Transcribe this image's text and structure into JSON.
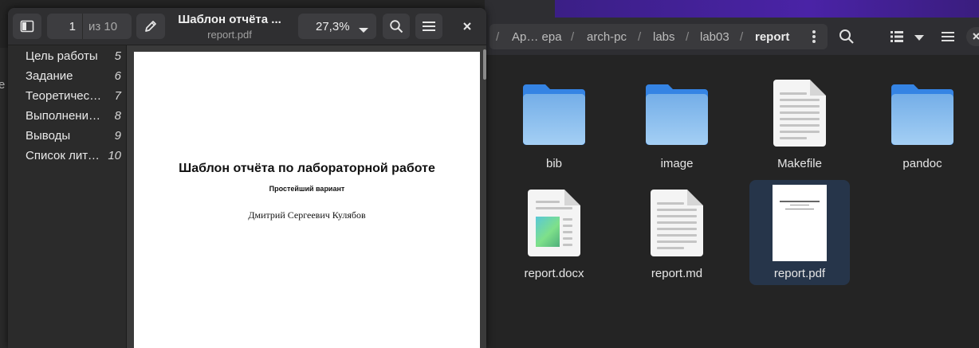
{
  "file_manager": {
    "breadcrumbs": [
      "Ар… ера",
      "arch-pc",
      "labs",
      "lab03",
      "report"
    ],
    "separator": "/",
    "files": [
      {
        "name": "bib",
        "type": "folder",
        "selected": false
      },
      {
        "name": "image",
        "type": "folder",
        "selected": false
      },
      {
        "name": "Makefile",
        "type": "text",
        "selected": false
      },
      {
        "name": "pandoc",
        "type": "folder",
        "selected": false
      },
      {
        "name": "report.docx",
        "type": "docx",
        "selected": false
      },
      {
        "name": "report.md",
        "type": "text",
        "selected": false
      },
      {
        "name": "report.pdf",
        "type": "pdf",
        "selected": true
      }
    ],
    "icons": {
      "path_menu": "vertical-dots-icon",
      "search": "search-icon",
      "view": "list-view-icon",
      "view_menu": "chevron-down-icon",
      "menu": "hamburger-icon",
      "close": "close-icon"
    }
  },
  "viewer": {
    "title": "Шаблон отчёта ...",
    "filename": "report.pdf",
    "page_current": "1",
    "page_total_label": "из 10",
    "zoom": "27,3%",
    "icons": {
      "sidebar_toggle": "sidebar-toggle-icon",
      "annotate": "pencil-icon",
      "search": "search-icon",
      "menu": "hamburger-icon",
      "close": "close-icon",
      "zoom_dropdown": "caret-down-icon"
    },
    "toc": [
      {
        "label": "Цель работы",
        "page": "5"
      },
      {
        "label": "Задание",
        "page": "6"
      },
      {
        "label": "Теоретичес…",
        "page": "7"
      },
      {
        "label": "Выполнение…",
        "page": "8"
      },
      {
        "label": "Выводы",
        "page": "9"
      },
      {
        "label": "Список лите…",
        "page": "10"
      }
    ],
    "page_content": {
      "title": "Шаблон отчёта по лабораторной работе",
      "subtitle": "Простейший вариант",
      "author": "Дмитрий Сергеевич Кулябов"
    }
  },
  "colors": {
    "folder_blue": "#78b4ea",
    "selection": "#26354a",
    "background": "#242424"
  }
}
